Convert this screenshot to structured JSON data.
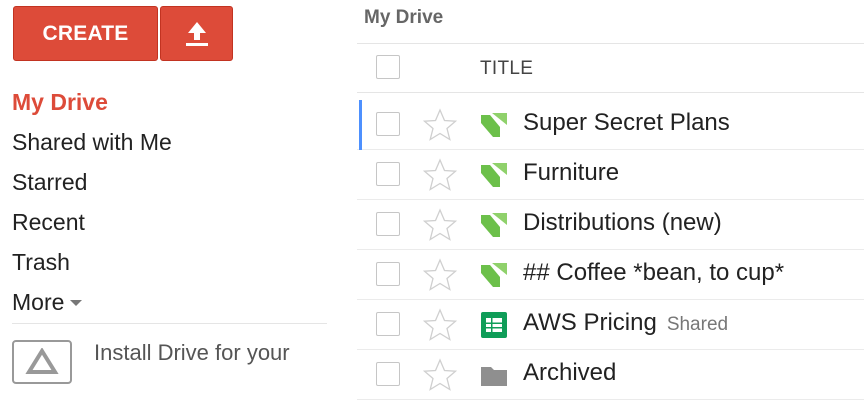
{
  "sidebar": {
    "create_label": "CREATE",
    "upload_icon": "upload-arrow-icon",
    "nav": [
      {
        "label": "My Drive",
        "active": true
      },
      {
        "label": "Shared with Me",
        "active": false
      },
      {
        "label": "Starred",
        "active": false
      },
      {
        "label": "Recent",
        "active": false
      },
      {
        "label": "Trash",
        "active": false
      }
    ],
    "more_label": "More",
    "install_text": "Install Drive for your"
  },
  "main": {
    "breadcrumb": "My Drive",
    "column_title": "TITLE",
    "rows": [
      {
        "name": "Super Secret Plans",
        "type": "doc",
        "shared": "",
        "selected": true
      },
      {
        "name": "Furniture",
        "type": "doc",
        "shared": "",
        "selected": false
      },
      {
        "name": "Distributions (new)",
        "type": "doc",
        "shared": "",
        "selected": false
      },
      {
        "name": "## Coffee *bean, to cup*",
        "type": "doc",
        "shared": "",
        "selected": false
      },
      {
        "name": "AWS Pricing",
        "type": "sheet",
        "shared": "Shared",
        "selected": false
      },
      {
        "name": "Archived",
        "type": "folder",
        "shared": "",
        "selected": false
      }
    ]
  },
  "colors": {
    "accent_red": "#dd4b39",
    "selection_blue": "#4d90fe",
    "doc_green": "#6cc04a",
    "sheet_green": "#0f9d58",
    "folder_gray": "#8f8f8f"
  }
}
